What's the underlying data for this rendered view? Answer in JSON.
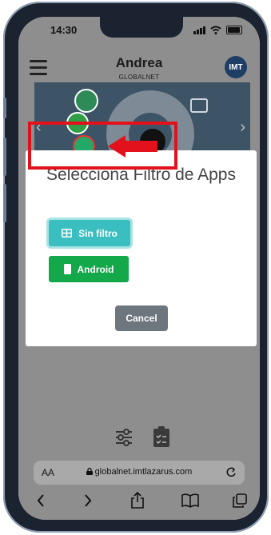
{
  "status_bar": {
    "time": "14:30"
  },
  "header": {
    "user_name": "Andrea",
    "org_name": "GLOBALNET",
    "avatar_text": "IMT"
  },
  "modal": {
    "title": "Selecciona Filtro de Apps",
    "buttons": {
      "no_filter": "Sin filtro",
      "android": "Android",
      "cancel": "Cancel"
    }
  },
  "browser": {
    "aa_label": "AA",
    "url": "globalnet.imtlazarus.com"
  },
  "colors": {
    "teal": "#3bbec0",
    "green": "#13a84a",
    "gray_button": "#6d757d",
    "highlight_red": "#e1121c"
  }
}
